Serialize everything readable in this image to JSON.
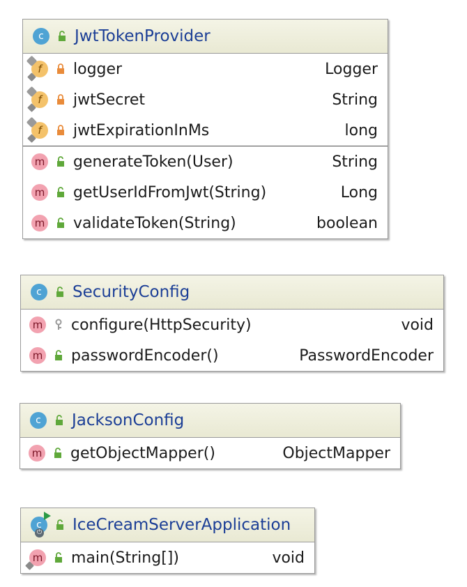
{
  "classes": [
    {
      "name": "JwtTokenProvider",
      "icon": "class-icon",
      "visibility": "public",
      "fields": [
        {
          "name": "logger",
          "type": "Logger",
          "visibility": "private",
          "icon": "static-final-field-icon"
        },
        {
          "name": "jwtSecret",
          "type": "String",
          "visibility": "private",
          "icon": "final-field-icon"
        },
        {
          "name": "jwtExpirationInMs",
          "type": "long",
          "visibility": "private",
          "icon": "final-field-icon"
        }
      ],
      "methods": [
        {
          "name": "generateToken(User)",
          "type": "String",
          "visibility": "public",
          "icon": "method-icon"
        },
        {
          "name": "getUserIdFromJwt(String)",
          "type": "Long",
          "visibility": "public",
          "icon": "method-icon"
        },
        {
          "name": "validateToken(String)",
          "type": "boolean",
          "visibility": "public",
          "icon": "method-icon"
        }
      ]
    },
    {
      "name": "SecurityConfig",
      "icon": "class-icon",
      "visibility": "public",
      "methods": [
        {
          "name": "configure(HttpSecurity)",
          "type": "void",
          "visibility": "protected",
          "icon": "method-icon"
        },
        {
          "name": "passwordEncoder()",
          "type": "PasswordEncoder",
          "visibility": "public",
          "icon": "method-icon"
        }
      ]
    },
    {
      "name": "JacksonConfig",
      "icon": "class-icon",
      "visibility": "public",
      "methods": [
        {
          "name": "getObjectMapper()",
          "type": "ObjectMapper",
          "visibility": "public",
          "icon": "method-icon"
        }
      ]
    },
    {
      "name": "IceCreamServerApplication",
      "icon": "spring-boot-application-icon",
      "visibility": "public",
      "methods": [
        {
          "name": "main(String[])",
          "type": "void",
          "visibility": "public",
          "icon": "static-method-icon"
        }
      ]
    }
  ],
  "colors": {
    "class_name": "#1b3e96",
    "header_background": "#ecebd6",
    "class_badge": "#4fa3d4",
    "method_badge": "#f2a2b0",
    "field_badge": "#f4c26a",
    "public_lock": "#5fa83a",
    "private_lock": "#e98b3a",
    "protected_key": "#9a9a9a",
    "border": "#9a9a9a"
  },
  "icon_letters": {
    "class": "c",
    "method": "m",
    "field": "f",
    "power": "⏻"
  }
}
